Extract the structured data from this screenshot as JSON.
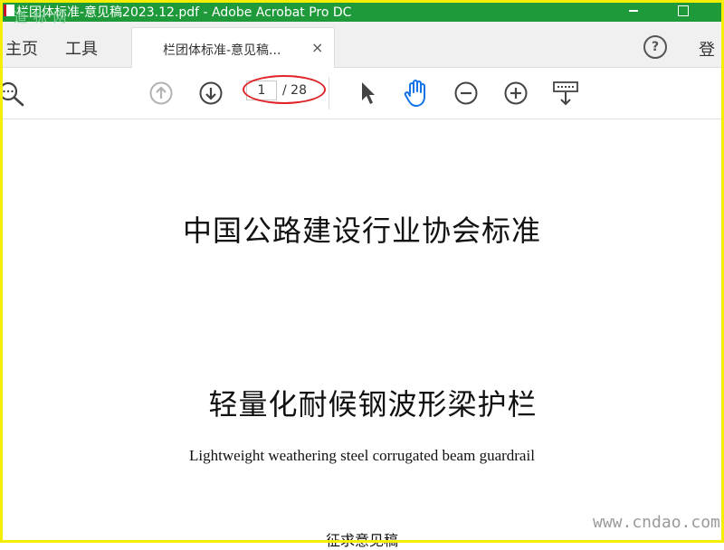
{
  "window": {
    "title": "栏团体标准-意见稿2023.12.pdf - Adobe Acrobat Pro DC"
  },
  "watermark": {
    "top_left": "道 标 网",
    "bottom_right": "www.cndao.com"
  },
  "nav": {
    "home": "主页",
    "tools": "工具",
    "login": "登"
  },
  "tab": {
    "label": "栏团体标准-意见稿...",
    "close": "×"
  },
  "help": {
    "label": "?"
  },
  "toolbar": {
    "page_current": "1",
    "page_total": "/ 28"
  },
  "icons": {
    "search": "search-icon",
    "prev_page": "arrow-up-circle-icon",
    "next_page": "arrow-down-circle-icon",
    "select": "cursor-arrow-icon",
    "hand": "hand-icon",
    "zoom_out": "minus-circle-icon",
    "zoom_in": "plus-circle-icon",
    "tools_more": "keyboard-down-icon"
  },
  "colors": {
    "titlebar": "#1f9a3a",
    "frame": "#f5ee00",
    "annotation": "#e0242a",
    "hand_active": "#1473e6"
  },
  "document": {
    "org": "中国公路建设行业协会标准",
    "title_cn": "轻量化耐候钢波形梁护栏",
    "title_en": "Lightweight weathering steel corrugated beam guardrail",
    "status": "征求意见稿"
  }
}
